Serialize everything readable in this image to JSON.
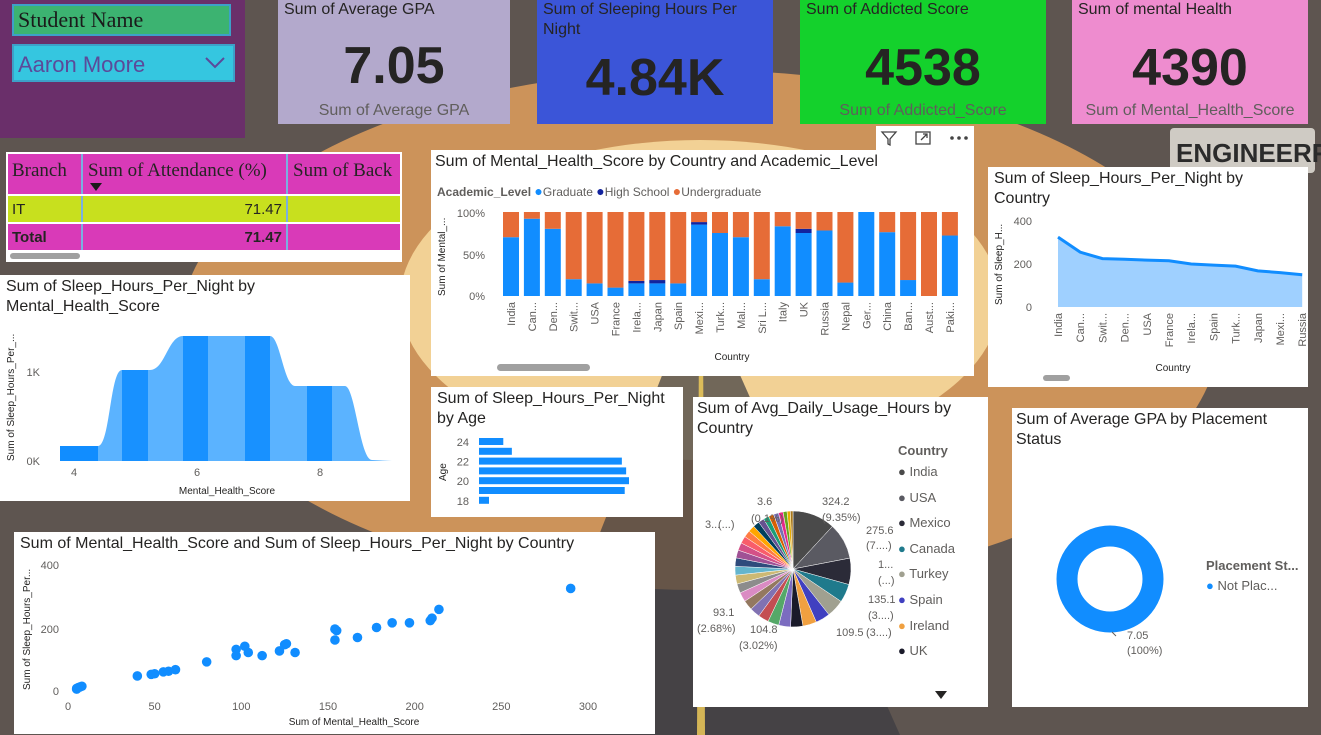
{
  "slicer": {
    "title": "Student Name",
    "value": "Aaron Moore"
  },
  "cards": [
    {
      "title": "Sum of Average GPA",
      "value": "7.05",
      "subtitle": "Sum of Average GPA",
      "bg": "#b3a9cc"
    },
    {
      "title": "Sum of Sleeping Hours Per Night",
      "value": "4.84K",
      "subtitle": "",
      "bg": "#3b55d8"
    },
    {
      "title": "Sum of Addicted Score",
      "value": "4538",
      "subtitle": "Sum of Addicted_Score",
      "bg": "#14d12c"
    },
    {
      "title": "Sum of mental Health",
      "value": "4390",
      "subtitle": "Sum of Mental_Health_Score",
      "bg": "#ee8ccf"
    }
  ],
  "table": {
    "headers": [
      "Branch",
      "Sum of Attendance (%)",
      "Sum of Back"
    ],
    "rows": [
      [
        "IT",
        "71.47",
        ""
      ]
    ],
    "total": [
      "Total",
      "71.47",
      ""
    ]
  },
  "bar100": {
    "title": "Sum of Mental_Health_Score by Country and Academic_Level",
    "legend_title": "Academic_Level",
    "legend": [
      "Graduate",
      "High School",
      "Undergraduate"
    ],
    "y_ticks": [
      "100%",
      "50%",
      "0%"
    ],
    "ylabel": "Sum of Mental_...",
    "xlabel": "Country"
  },
  "area_country": {
    "title": "Sum of Sleep_Hours_Per_Night by Country",
    "y_ticks": [
      "400",
      "200",
      "0"
    ],
    "ylabel": "Sum of Sleep_H...",
    "xlabel": "Country"
  },
  "area_mh": {
    "title": "Sum of Sleep_Hours_Per_Night by Mental_Health_Score",
    "y_ticks": [
      "1K",
      "0K"
    ],
    "x_ticks": [
      "4",
      "6",
      "8"
    ],
    "ylabel": "Sum of Sleep_Hours_Per_...",
    "xlabel": "Mental_Health_Score"
  },
  "bar_age": {
    "title": "Sum of Sleep_Hours_Per_Night by Age",
    "ylabel": "Age"
  },
  "pie": {
    "title": "Sum of Avg_Daily_Usage_Hours by Country",
    "legend_title": "Country",
    "legend": [
      {
        "name": "India",
        "color": "#4a4a4a"
      },
      {
        "name": "USA",
        "color": "#5a5a62"
      },
      {
        "name": "Mexico",
        "color": "#2b2b38"
      },
      {
        "name": "Canada",
        "color": "#1f7a8c"
      },
      {
        "name": "Turkey",
        "color": "#a0a090"
      },
      {
        "name": "Spain",
        "color": "#4040c0"
      },
      {
        "name": "Ireland",
        "color": "#f0a040"
      },
      {
        "name": "UK",
        "color": "#1a1a2a"
      }
    ],
    "labels": [
      "3.6",
      "(0.1%)",
      "324.2",
      "(9.35%)",
      "275.6",
      "(7....)",
      "1...",
      "(...)",
      "135.1",
      "(3....)",
      "109.5",
      "(3....)",
      "104.8",
      "(3.02%)",
      "93.1",
      "(2.68%)",
      "3...",
      "(...)"
    ]
  },
  "donut": {
    "title": "Sum of Average GPA by Placement Status",
    "legend_title": "Placement St...",
    "legend": [
      "Not Plac..."
    ],
    "label_value": "7.05",
    "label_pct": "(100%)"
  },
  "scatter": {
    "title": "Sum of Mental_Health_Score and Sum of Sleep_Hours_Per_Night by Country",
    "xlabel": "Sum of Mental_Health_Score",
    "ylabel": "Sum of Sleep_Hours_Per...",
    "x_ticks": [
      "0",
      "50",
      "100",
      "150",
      "200",
      "250",
      "300"
    ],
    "y_ticks": [
      "400",
      "200",
      "0"
    ]
  },
  "colors": {
    "primary": "#118dff",
    "dark": "#12239e",
    "orange": "#e66c37"
  },
  "chart_data": [
    {
      "type": "bar",
      "title": "Sum of Mental_Health_Score by Country and Academic_Level",
      "categories": [
        "India",
        "Can...",
        "Den...",
        "Swit...",
        "USA",
        "France",
        "Irela...",
        "Japan",
        "Spain",
        "Mexi...",
        "Turk...",
        "Mal...",
        "Sri L...",
        "Italy",
        "UK",
        "Russia",
        "Nepal",
        "Ger...",
        "China",
        "Ban...",
        "Aust...",
        "Paki..."
      ],
      "series": [
        {
          "name": "Graduate",
          "values": [
            70,
            92,
            80,
            20,
            15,
            10,
            15,
            15,
            15,
            85,
            75,
            70,
            20,
            83,
            75,
            78,
            16,
            100,
            76,
            19,
            0,
            72
          ]
        },
        {
          "name": "High School",
          "values": [
            0,
            0,
            0,
            0,
            0,
            0,
            3,
            4,
            0,
            3,
            0,
            0,
            0,
            0,
            5,
            0,
            0,
            0,
            0,
            0,
            0,
            0
          ]
        },
        {
          "name": "Undergraduate",
          "values": [
            30,
            8,
            20,
            80,
            85,
            90,
            82,
            81,
            85,
            12,
            25,
            30,
            80,
            17,
            20,
            22,
            84,
            0,
            24,
            81,
            100,
            28
          ]
        }
      ],
      "ylim": [
        0,
        100
      ]
    },
    {
      "type": "area",
      "title": "Sum of Sleep_Hours_Per_Night by Country",
      "categories": [
        "India",
        "Can...",
        "Swit...",
        "Den...",
        "USA",
        "France",
        "Irela...",
        "Spain",
        "Turk...",
        "Japan",
        "Mexi...",
        "Russia"
      ],
      "values": [
        325,
        255,
        225,
        222,
        218,
        215,
        200,
        195,
        190,
        168,
        160,
        150
      ],
      "ylim": [
        0,
        400
      ]
    },
    {
      "type": "area",
      "title": "Sum of Sleep_Hours_Per_Night by Mental_Health_Score",
      "x": [
        3.7,
        4,
        4.5,
        5,
        5.5,
        6,
        6.5,
        7,
        7.5,
        8,
        8.5,
        9
      ],
      "values": [
        160,
        160,
        600,
        1040,
        1050,
        1380,
        1380,
        1340,
        1340,
        850,
        850,
        0
      ]
    },
    {
      "type": "bar",
      "title": "Sum of Sleep_Hours_Per_Night by Age",
      "categories": [
        "24",
        "23",
        "22",
        "21",
        "20",
        "19",
        "18"
      ],
      "values": [
        85,
        115,
        500,
        515,
        525,
        510,
        35
      ]
    },
    {
      "type": "scatter",
      "title": "Sum of Mental_Health_Score and Sum of Sleep_Hours_Per_Night by Country",
      "x": [
        5,
        6,
        7,
        8,
        5,
        40,
        48,
        50,
        55,
        58,
        62,
        80,
        97,
        97,
        102,
        104,
        112,
        122,
        125,
        126,
        131,
        154,
        155,
        154,
        167,
        178,
        187,
        197,
        209,
        210,
        214,
        290
      ],
      "y": [
        5,
        8,
        10,
        12,
        3,
        45,
        50,
        52,
        58,
        60,
        65,
        90,
        110,
        130,
        140,
        120,
        110,
        125,
        145,
        148,
        120,
        160,
        190,
        195,
        168,
        200,
        215,
        215,
        222,
        230,
        258,
        325
      ],
      "xlim": [
        0,
        300
      ],
      "ylim": [
        0,
        400
      ]
    },
    {
      "type": "pie",
      "title": "Sum of Avg_Daily_Usage_Hours by Country",
      "labels": [
        "India",
        "USA",
        "Mexico",
        "Canada",
        "Turkey",
        "Spain",
        "Ireland",
        "UK"
      ],
      "values": [
        324.2,
        275.6,
        200,
        140,
        135.1,
        109.5,
        104.8,
        93.1
      ]
    },
    {
      "type": "pie",
      "title": "Sum of Average GPA by Placement Status",
      "labels": [
        "Not Plac..."
      ],
      "values": [
        7.05
      ]
    }
  ]
}
